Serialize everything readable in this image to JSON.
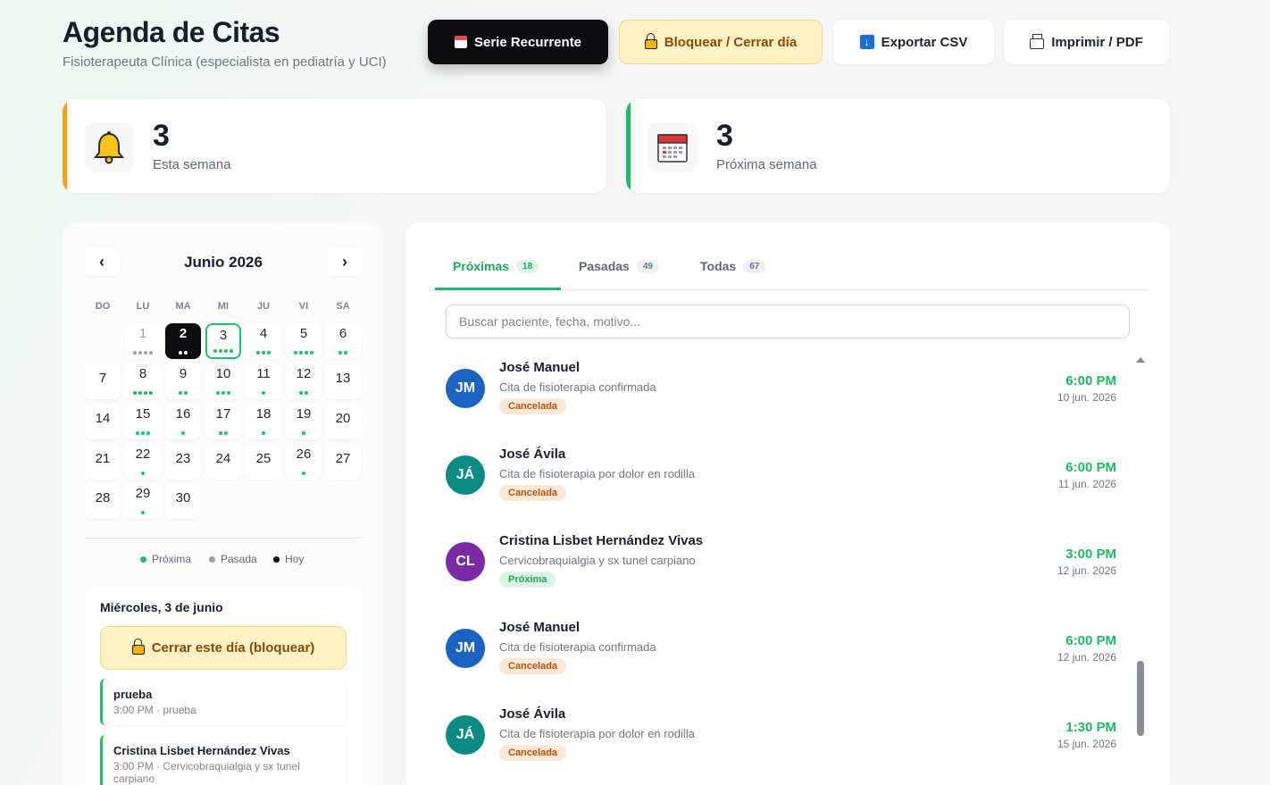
{
  "header": {
    "title": "Agenda de Citas",
    "subtitle": "Fisioterapeuta Clínica (especialista en pediatría y UCI)"
  },
  "toolbar": {
    "recurring": "Serie Recurrente",
    "block": "Bloquear / Cerrar día",
    "export": "Exportar CSV",
    "print": "Imprimir / PDF"
  },
  "stats": [
    {
      "value": "3",
      "label": "Esta semana",
      "icon": "bell-icon",
      "color": "#f5a31a"
    },
    {
      "value": "3",
      "label": "Próxima semana",
      "icon": "calendar-icon",
      "color": "#1ebd6a"
    }
  ],
  "calendar": {
    "month": "Junio 2026",
    "prev": "‹",
    "next": "›",
    "weekdays": [
      "DO",
      "LU",
      "MA",
      "MI",
      "JU",
      "VI",
      "SA"
    ],
    "days": [
      {
        "d": "1",
        "dots": 4,
        "past": true
      },
      {
        "d": "2",
        "dots": 2,
        "today": true
      },
      {
        "d": "3",
        "dots": 4,
        "selected": true
      },
      {
        "d": "4",
        "dots": 3
      },
      {
        "d": "5",
        "dots": 4
      },
      {
        "d": "6",
        "dots": 2
      },
      {
        "d": "7",
        "dots": 0
      },
      {
        "d": "8",
        "dots": 4
      },
      {
        "d": "9",
        "dots": 2
      },
      {
        "d": "10",
        "dots": 3
      },
      {
        "d": "11",
        "dots": 1
      },
      {
        "d": "12",
        "dots": 2
      },
      {
        "d": "13",
        "dots": 0
      },
      {
        "d": "14",
        "dots": 0
      },
      {
        "d": "15",
        "dots": 3
      },
      {
        "d": "16",
        "dots": 1
      },
      {
        "d": "17",
        "dots": 2
      },
      {
        "d": "18",
        "dots": 1
      },
      {
        "d": "19",
        "dots": 1
      },
      {
        "d": "20",
        "dots": 0
      },
      {
        "d": "21",
        "dots": 0
      },
      {
        "d": "22",
        "dots": 1
      },
      {
        "d": "23",
        "dots": 0
      },
      {
        "d": "24",
        "dots": 0
      },
      {
        "d": "25",
        "dots": 0
      },
      {
        "d": "26",
        "dots": 1
      },
      {
        "d": "27",
        "dots": 0
      },
      {
        "d": "28",
        "dots": 0
      },
      {
        "d": "29",
        "dots": 1
      },
      {
        "d": "30",
        "dots": 0
      }
    ],
    "legend": {
      "upcoming": "Próxima",
      "past": "Pasada",
      "today": "Hoy"
    }
  },
  "day_panel": {
    "title": "Miércoles, 3 de junio",
    "block_button": "Cerrar este día (bloquear)",
    "items": [
      {
        "name": "prueba",
        "detail": "3:00 PM · prueba"
      },
      {
        "name": "Cristina Lisbet Hernández Vivas",
        "detail": "3:00 PM · Cervicobraquialgia y sx tunel carpiano"
      }
    ]
  },
  "tabs": [
    {
      "label": "Próximas",
      "count": "18",
      "active": true
    },
    {
      "label": "Pasadas",
      "count": "49"
    },
    {
      "label": "Todas",
      "count": "67"
    }
  ],
  "search": {
    "placeholder": "Buscar paciente, fecha, motivo..."
  },
  "appointments": [
    {
      "initials": "JM",
      "avatar_color": "#1c63c0",
      "name": "José Manuel",
      "reason": "Cita de fisioterapia confirmada",
      "status": "Cancelada",
      "status_kind": "cancel",
      "time": "6:00 PM",
      "date": "10 jun. 2026"
    },
    {
      "initials": "JÁ",
      "avatar_color": "#0d8a83",
      "name": "José Ávila",
      "reason": "Cita de fisioterapia por dolor en rodilla",
      "status": "Cancelada",
      "status_kind": "cancel",
      "time": "6:00 PM",
      "date": "11 jun. 2026"
    },
    {
      "initials": "CL",
      "avatar_color": "#7b2aa6",
      "name": "Cristina Lisbet Hernández Vivas",
      "reason": "Cervicobraquialgia y sx tunel carpiano",
      "status": "Próxima",
      "status_kind": "next",
      "time": "3:00 PM",
      "date": "12 jun. 2026"
    },
    {
      "initials": "JM",
      "avatar_color": "#1c63c0",
      "name": "José Manuel",
      "reason": "Cita de fisioterapia confirmada",
      "status": "Cancelada",
      "status_kind": "cancel",
      "time": "6:00 PM",
      "date": "12 jun. 2026"
    },
    {
      "initials": "JÁ",
      "avatar_color": "#0d8a83",
      "name": "José Ávila",
      "reason": "Cita de fisioterapia por dolor en rodilla",
      "status": "Cancelada",
      "status_kind": "cancel",
      "time": "1:30 PM",
      "date": "15 jun. 2026"
    }
  ]
}
